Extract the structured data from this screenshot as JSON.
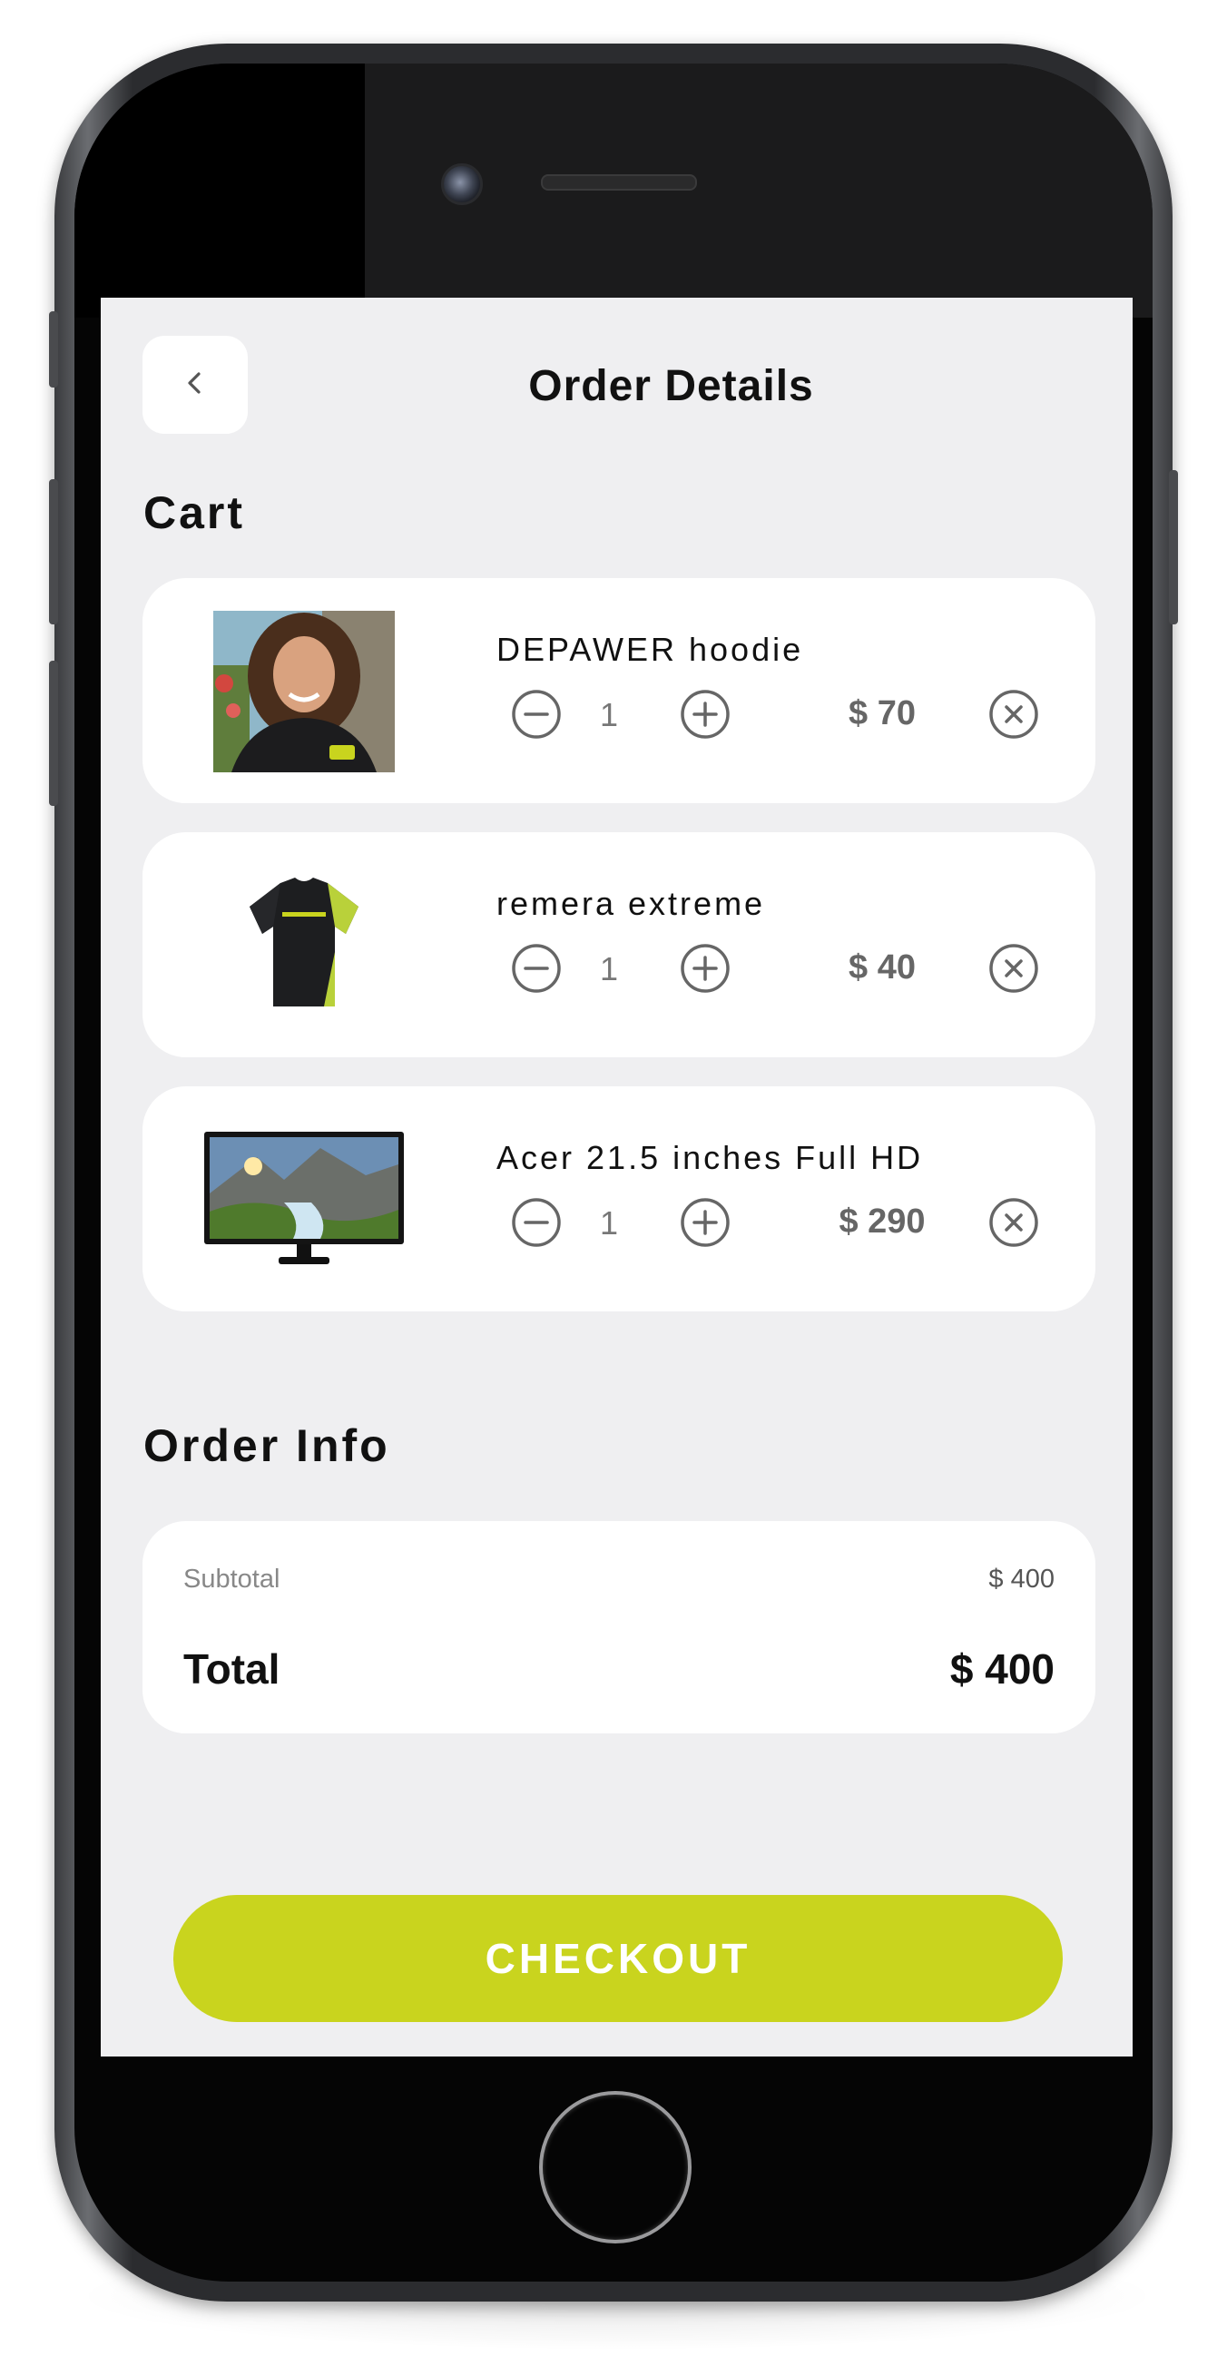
{
  "header": {
    "title": "Order Details",
    "back_icon": "chevron-left-icon"
  },
  "cart": {
    "title": "Cart",
    "items": [
      {
        "name": "DEPAWER hoodie",
        "quantity": "1",
        "price": "$ 70",
        "image": "hoodie-person-photo"
      },
      {
        "name": "remera extreme",
        "quantity": "1",
        "price": "$ 40",
        "image": "tshirt-photo"
      },
      {
        "name": "Acer 21.5 inches Full HD",
        "quantity": "1",
        "price": "$ 290",
        "image": "monitor-photo"
      }
    ],
    "icons": {
      "decrease": "minus-circle-icon",
      "increase": "plus-circle-icon",
      "remove": "close-circle-icon"
    }
  },
  "order_info": {
    "title": "Order Info",
    "subtotal_label": "Subtotal",
    "subtotal_value": "$ 400",
    "total_label": "Total",
    "total_value": "$ 400"
  },
  "checkout": {
    "label": "CHECKOUT"
  },
  "colors": {
    "accent": "#c9d41e",
    "screen_background": "#efeff1",
    "card_background": "#ffffff",
    "phone_body": "#2b2c2f"
  }
}
